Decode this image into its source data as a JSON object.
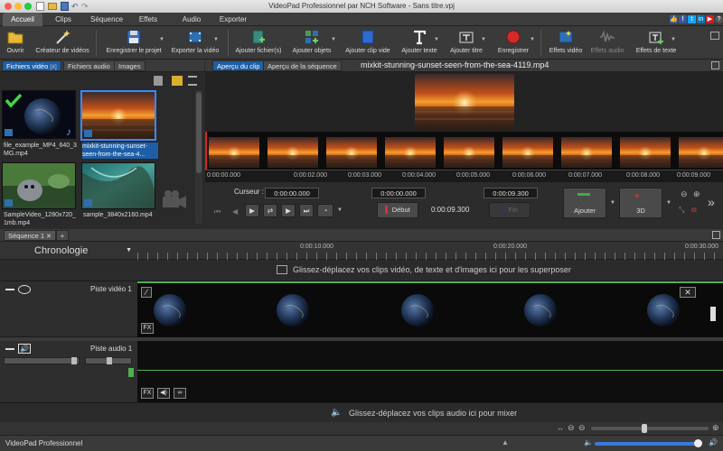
{
  "window": {
    "title": "VideoPad Professionnel par NCH Software - Sans titre.vpj"
  },
  "menu_tabs": [
    "Accueil",
    "Clips",
    "Séquence",
    "Effets",
    "Audio",
    "Exporter"
  ],
  "toolbar": {
    "open": "Ouvrir",
    "video_creator": "Créateur de vidéos",
    "save_project": "Enregistrer le projet",
    "export_video": "Exporter la vidéo",
    "add_files": "Ajouter fichier(s)",
    "add_objects": "Ajouter objets",
    "add_blank_clip": "Ajouter clip vide",
    "add_text": "Ajouter texte",
    "add_title": "Ajouter titre",
    "record": "Enregistrer",
    "video_effects": "Effets vidéo",
    "audio_effects": "Effets audio",
    "text_effects": "Effets de texte"
  },
  "bin": {
    "tabs": [
      "Fichiers vidéo",
      "Fichiers audio",
      "Images"
    ],
    "items": [
      {
        "name": "file_example_MP4_640_3MG.mp4",
        "line1": "file_example_MP4_640_3",
        "line2": "MG.mp4"
      },
      {
        "name": "mixkit-stunning-sunset-seen-from-the-sea-4...",
        "line1": "mixkit-stunning-sunset-",
        "line2": "seen-from-the-sea-4..."
      },
      {
        "name": "SampleVideo_1280x720_1mb.mp4",
        "line1": "SampleVideo_1280x720_",
        "line2": "1mb.mp4"
      },
      {
        "name": "sample_3840x2160.mp4",
        "line1": "sample_3840x2160.mp4",
        "line2": ""
      }
    ]
  },
  "preview": {
    "tabs": [
      "Aperçu du clip",
      "Aperçu de la séquence"
    ],
    "clip_title": "mixkit-stunning-sunset-seen-from-the-sea-4119.mp4",
    "ruler": [
      "0:00:00.000",
      "0:00:02.000",
      "0:00:03.000",
      "0:00:04.000",
      "0:00:05.000",
      "0:00:06.000",
      "0:00:07.000",
      "0:00:08.000",
      "0:00:09.000"
    ],
    "cursor_label": "Curseur :",
    "cursor_value": "0:00:00.000",
    "start_value": "0:00:00.000",
    "end_value": "0:00:09.300",
    "duration": "0:00:09.300",
    "start_label": "Début",
    "end_label": "Fin",
    "add_label": "Ajouter",
    "threed_label": "3D"
  },
  "sequence": {
    "tab": "Séquence 1",
    "timeline_label": "Chronologie",
    "ruler": [
      "0:00:10.000",
      "0:00:20.000",
      "0:00:30.000"
    ],
    "overlay_hint": "Glissez-déplacez vos clips vidéo, de texte et d'images ici pour les superposer",
    "video_track": "Piste vidéo 1",
    "audio_track": "Piste audio 1",
    "audio_hint": "Glissez-déplacez vos clips audio ici pour mixer",
    "fx": "FX"
  },
  "status": {
    "app_name": "VideoPad Professionnel"
  },
  "social": [
    "f",
    "t",
    "in",
    "▶"
  ],
  "help": "?"
}
